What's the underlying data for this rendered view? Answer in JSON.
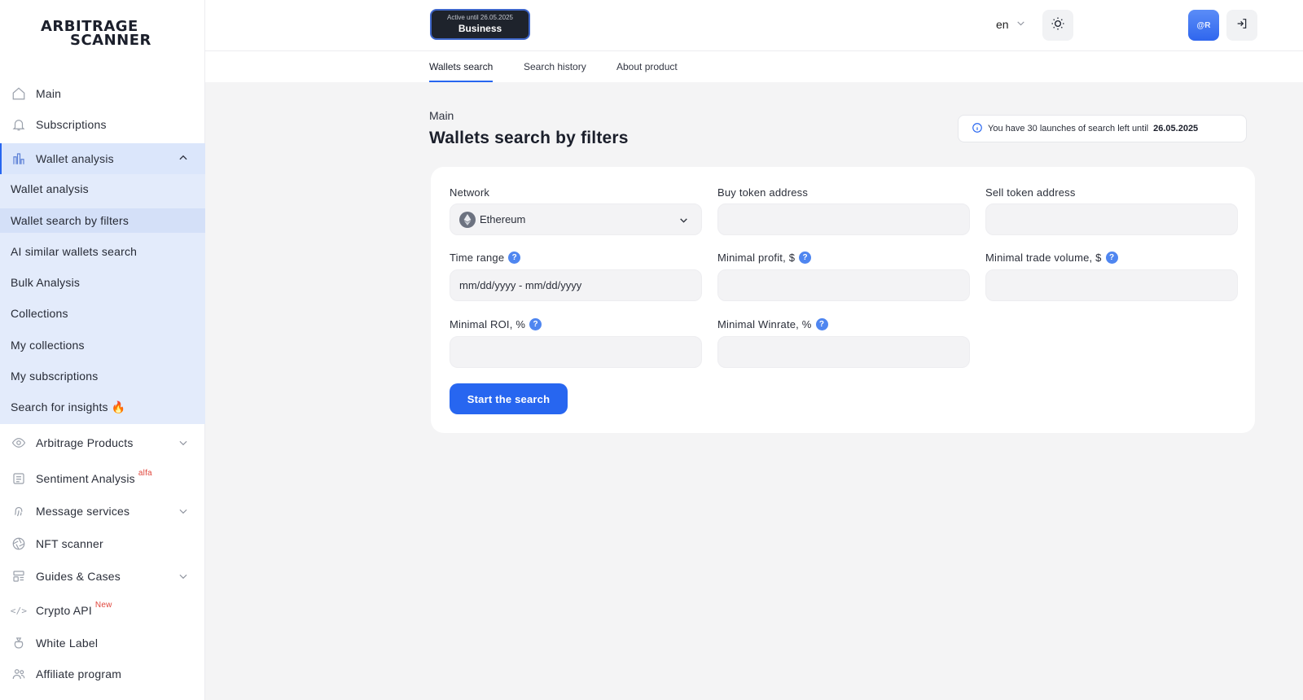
{
  "brand": {
    "line1": "ARBITRAGE",
    "line2": "SCANNER"
  },
  "sidebar": {
    "items": [
      {
        "label": "Main",
        "icon": "home-icon"
      },
      {
        "label": "Subscriptions",
        "icon": "bell-icon"
      },
      {
        "label": "Wallet analysis",
        "icon": "bar-chart-icon"
      },
      {
        "label": "Arbitrage Products",
        "icon": "eye-icon"
      },
      {
        "label": "Sentiment Analysis",
        "badge": "alfa",
        "icon": "newspaper-icon"
      },
      {
        "label": "Message services",
        "icon": "fingerprint-icon"
      },
      {
        "label": "NFT scanner",
        "icon": "aperture-icon"
      },
      {
        "label": "Guides & Cases",
        "icon": "layout-icon"
      },
      {
        "label": "Crypto API",
        "badge": "New",
        "icon": "code-icon"
      },
      {
        "label": "White Label",
        "icon": "moneybag-icon"
      },
      {
        "label": "Affiliate program",
        "icon": "users-icon"
      }
    ],
    "submenu": [
      "Wallet analysis",
      "Wallet search by filters",
      "AI similar wallets search",
      "Bulk Analysis",
      "Collections",
      "My collections",
      "My subscriptions",
      "Search for insights 🔥"
    ]
  },
  "header": {
    "plan_status": "Active until 26.05.2025",
    "plan_name": "Business",
    "language": "en",
    "avatar_text": "@R"
  },
  "tabs": [
    "Wallets search",
    "Search history",
    "About product"
  ],
  "page": {
    "breadcrumb": "Main",
    "title": "Wallets search by filters",
    "notice_prefix": "You have 30 launches of search left until",
    "notice_date": "26.05.2025"
  },
  "form": {
    "network_label": "Network",
    "network_value": "Ethereum",
    "buy_label": "Buy token address",
    "sell_label": "Sell token address",
    "time_label": "Time range",
    "time_placeholder": "mm/dd/yyyy - mm/dd/yyyy",
    "profit_label": "Minimal profit, $",
    "volume_label": "Minimal trade volume, $",
    "roi_label": "Minimal ROI, %",
    "winrate_label": "Minimal Winrate, %",
    "submit_label": "Start the search"
  },
  "colors": {
    "accent": "#2766f0",
    "submenu_bg": "#e3ebfb",
    "badge_red": "#e0463c"
  }
}
